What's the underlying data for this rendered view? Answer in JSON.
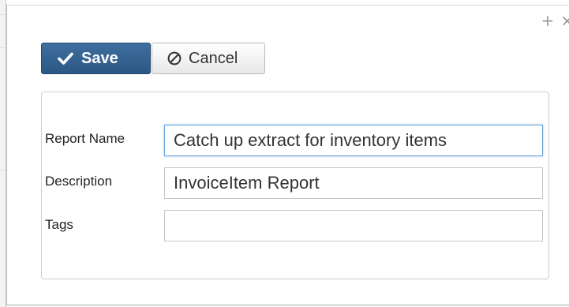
{
  "dialog": {
    "controls": {
      "expand_glyph": "+",
      "close_glyph": "×"
    },
    "toolbar": {
      "save_label": "Save",
      "cancel_label": "Cancel"
    },
    "form": {
      "report_name": {
        "label": "Report Name",
        "value": "Catch up extract for inventory items"
      },
      "description": {
        "label": "Description",
        "value": "InvoiceItem Report"
      },
      "tags": {
        "label": "Tags",
        "value": ""
      }
    }
  },
  "colors": {
    "save_button": "#2c5783",
    "focus_border": "#66a2d8"
  },
  "icons": {
    "save": "check-icon",
    "cancel": "no-entry-icon",
    "expand": "plus-icon",
    "close": "close-icon"
  }
}
